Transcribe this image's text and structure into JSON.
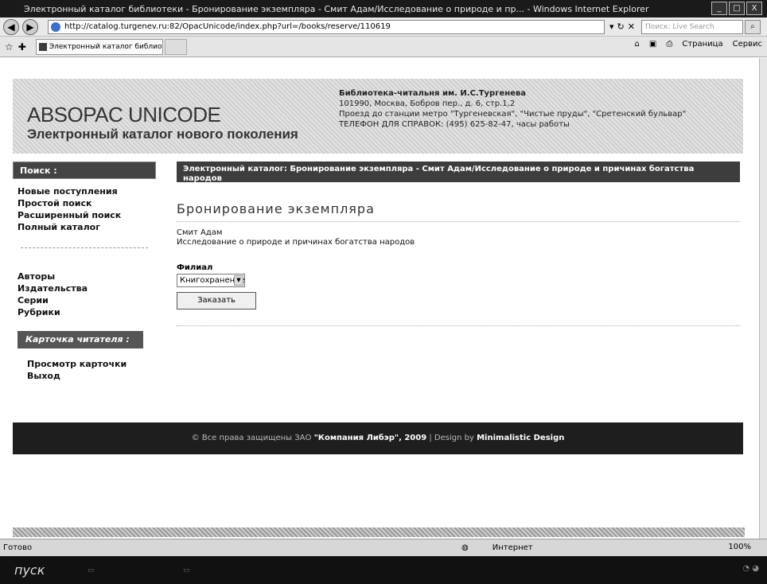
{
  "window": {
    "title": "Электронный каталог библиотеки - Бронирование экземпляра - Смит Адам/Исследование о природе и пр... - Windows Internet Explorer",
    "minimize": "_",
    "maximize": "□",
    "close": "X"
  },
  "addressbar": {
    "url": "http://catalog.turgenev.ru:82/OpacUnicode/index.php?url=/books/reserve/110619",
    "search_placeholder": "Поиск: Live Search",
    "back_icon": "back-arrow-icon",
    "forward_icon": "forward-arrow-icon"
  },
  "tabbar": {
    "tab_label": "Электронный каталог библиотеки - Бронирование...",
    "tools": [
      "Страница",
      "Сервис"
    ]
  },
  "header": {
    "logo_title": "ABSOPAC UNICODE",
    "logo_subtitle": "Электронный каталог нового поколения",
    "library_name": "Библиотека-читальня им. И.С.Тургенева",
    "address": "101990, Москва, Бобров пер., д. 6, стр.1,2",
    "directions": "Проезд до станции метро \"Тургеневская\", \"Чистые пруды\", \"Сретенский бульвар\"",
    "phone": "ТЕЛЕФОН ДЛЯ СПРАВОК: (495) 625-82-47, часы работы"
  },
  "sidebar": {
    "search_heading": "Поиск :",
    "search_links": [
      "Новые поступления",
      "Простой поиск",
      "Расширенный поиск",
      "Полный каталог"
    ],
    "index_links": [
      "Авторы",
      "Издательства",
      "Серии",
      "Рубрики"
    ],
    "card_heading": "Карточка читателя :",
    "card_links": [
      "Просмотр карточки",
      "Выход"
    ]
  },
  "content": {
    "breadcrumb": "Электронный каталог: Бронирование экземпляра - Смит Адам/Исследование о природе и причинах богатства народов",
    "page_title": "Бронирование экземпляра",
    "author": "Смит Адам",
    "book_title": "Исследование о природе и причинах богатства народов",
    "branch_label": "Филиал",
    "branch_selected": "Книгохранение",
    "order_button": "Заказать"
  },
  "footer": {
    "copyright": "© Все права защищены ЗАО",
    "company": "\"Компания Либэр\", 2009",
    "design_prefix": "| Design by",
    "design_by": "Minimalistic Design"
  },
  "statusbar": {
    "status": "Готово",
    "zone": "Интернет",
    "zoom": "100%"
  },
  "taskbar": {
    "start": "пуск"
  }
}
